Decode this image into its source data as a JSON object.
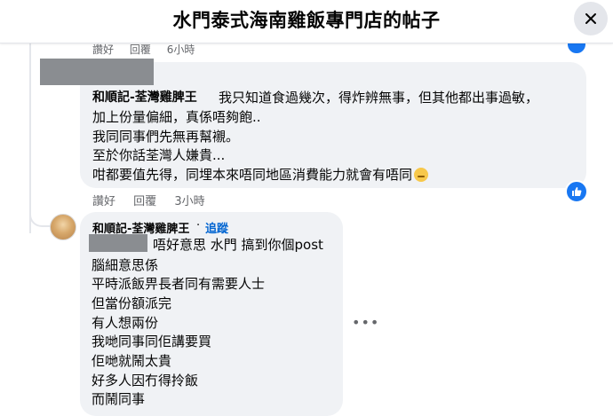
{
  "header": {
    "title": "水門泰式海南雞飯專門店的帖子"
  },
  "top_comment_actions": {
    "like": "讚好",
    "reply": "回覆",
    "time": "6小時"
  },
  "comment1": {
    "author": "和順記-荃灣雞脾王",
    "lines": [
      "我只知道食過幾次，得炸辨無事，但其他都出事過敏，",
      "加上份量偏細，真係唔夠飽..",
      "我同同事們先無再幫襯。",
      "至於你話荃灣人嫌貴...",
      "咁都要值先得，同埋本來唔同地區消費能力就會有唔同"
    ],
    "actions": {
      "like": "讚好",
      "reply": "回覆",
      "time": "3小時"
    }
  },
  "comment2": {
    "author": "和順記-荃灣雞脾王",
    "separator": "·",
    "follow": "追蹤",
    "first_line_text": "唔好意思 水門 搞到你個post",
    "lines": [
      "腦細意思係",
      "平時派飯畀長者同有需要人士",
      "但當份額派完",
      "有人想兩份",
      "我哋同事同佢講要買",
      "佢哋就鬧太貴",
      "好多人因冇得拎飯",
      "而鬧同事"
    ]
  },
  "icons": {
    "close": "close-icon",
    "like": "thumbs-up-icon",
    "more": "more-options-icon"
  },
  "colors": {
    "accent": "#1877f2",
    "link": "#0064d1",
    "bubble": "#f0f2f5",
    "muted": "#65676b"
  }
}
